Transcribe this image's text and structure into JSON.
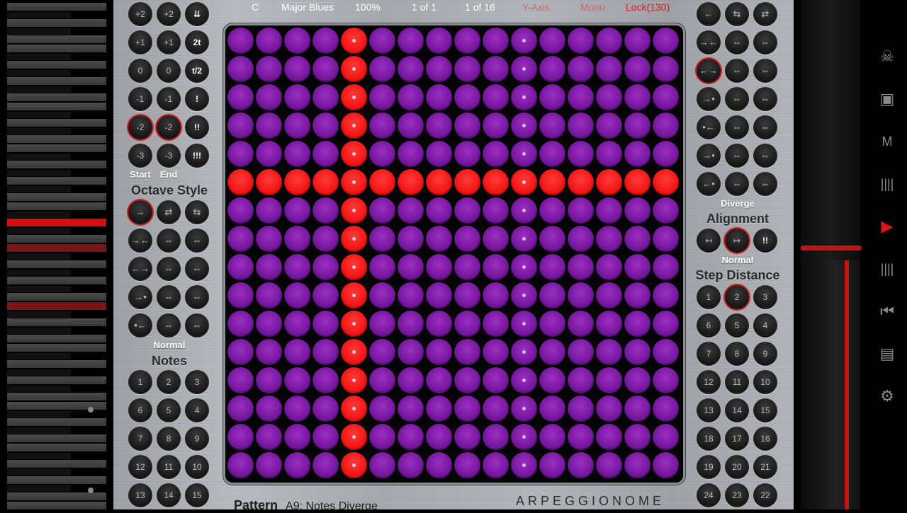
{
  "header": {
    "key": "C",
    "scale": "Major Blues",
    "zoom": "100%",
    "page_a": "1 of 1",
    "page_b": "1 of 16",
    "y_axis": "Y-Axis",
    "mono": "Mono",
    "lock": "Lock(130)"
  },
  "left": {
    "start_col": [
      "+2",
      "+1",
      "0",
      "-1",
      "-2",
      "-3"
    ],
    "end_col": [
      "+2",
      "+1",
      "0",
      "-1",
      "-2",
      "-3"
    ],
    "timing_col": [
      "⇊",
      "2t",
      "t/2",
      "!",
      "!!",
      "!!!"
    ],
    "start_label": "Start",
    "end_label": "End",
    "octave_style_title": "Octave Style",
    "octave_style_value": "Normal",
    "notes_title": "Notes",
    "notes_rows": [
      [
        "1",
        "2",
        "3"
      ],
      [
        "6",
        "5",
        "4"
      ],
      [
        "7",
        "8",
        "9"
      ],
      [
        "12",
        "11",
        "10"
      ],
      [
        "13",
        "14",
        "15"
      ]
    ]
  },
  "right": {
    "diverge_label": "Diverge",
    "alignment_title": "Alignment",
    "alignment_value": "Normal",
    "alignment_buttons": [
      "↤",
      "↦",
      "!!"
    ],
    "step_distance_title": "Step Distance",
    "step_rows": [
      [
        "1",
        "2",
        "3"
      ],
      [
        "6",
        "5",
        "4"
      ],
      [
        "7",
        "8",
        "9"
      ],
      [
        "12",
        "11",
        "10"
      ],
      [
        "13",
        "14",
        "15"
      ],
      [
        "18",
        "17",
        "16"
      ],
      [
        "19",
        "20",
        "21"
      ],
      [
        "24",
        "23",
        "22"
      ]
    ]
  },
  "footer": {
    "pattern_label": "Pattern",
    "pattern_value": "A9: Notes Diverge",
    "brand": "ARPEGGIONOME"
  },
  "grid": {
    "rows": 16,
    "cols": 16,
    "red_col": 4,
    "red_row": 5,
    "dot_cols": [
      4,
      10
    ]
  },
  "colors": {
    "pad": "#7b1ea8",
    "pad_active": "#ff1a1a",
    "accent": "#d61a1a"
  },
  "icons": [
    "skull-icon",
    "folder-icon",
    "m-icon",
    "bars-icon",
    "play-icon",
    "bars-icon",
    "skip-back-icon",
    "archive-icon",
    "gear-icon"
  ]
}
